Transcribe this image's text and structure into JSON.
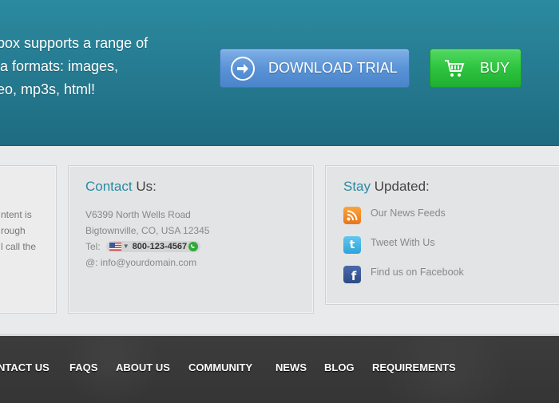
{
  "hero": {
    "lines": [
      "box supports a range of",
      "ia formats: images,",
      "eo, mp3s, html!"
    ],
    "download_label": "DOWNLOAD TRIAL",
    "buy_label": "BUY"
  },
  "left_panel": {
    "lines": [
      "ntent is",
      "rough",
      "l call the"
    ]
  },
  "contact": {
    "title_highlight": "Contact",
    "title_rest": " Us:",
    "address1": "V6399 North Wells Road",
    "address2": "Bigtownville, CO, USA 12345",
    "tel_label": "Tel:",
    "phone": "800-123-4567",
    "email_prefix": "@:",
    "email": "info@yourdomain.com"
  },
  "stay_updated": {
    "title_highlight": "Stay",
    "title_rest": " Updated:",
    "items": [
      {
        "label": "Our News Feeds",
        "icon": "rss-icon"
      },
      {
        "label": "Tweet With Us",
        "icon": "twitter-icon"
      },
      {
        "label": "Find us on Facebook",
        "icon": "facebook-icon"
      }
    ]
  },
  "nav": {
    "items": [
      "NTACT US",
      "FAQS",
      "ABOUT US",
      "COMMUNITY",
      "NEWS",
      "BLOG",
      "REQUIREMENTS"
    ]
  },
  "colors": {
    "accent": "#2a8aa2",
    "download": "#5a93d6",
    "buy": "#2ec43f"
  }
}
